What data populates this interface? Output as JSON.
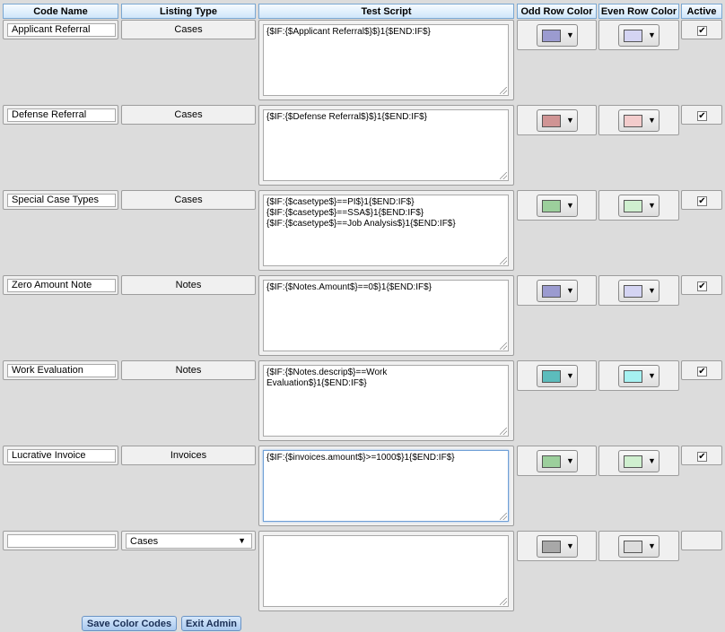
{
  "headers": {
    "code_name": "Code Name",
    "listing_type": "Listing Type",
    "test_script": "Test Script",
    "odd_row_color": "Odd Row Color",
    "even_row_color": "Even Row Color",
    "active": "Active"
  },
  "rows": [
    {
      "code_name": "Applicant Referral",
      "listing_type": "Cases",
      "script": "{$IF:{$Applicant Referral$}$}1{$END:IF$}",
      "odd_color": "#9b9bd0",
      "even_color": "#d4d4f3",
      "active": "✔"
    },
    {
      "code_name": "Defense Referral",
      "listing_type": "Cases",
      "script": "{$IF:{$Defense Referral$}$}1{$END:IF$}",
      "odd_color": "#d09494",
      "even_color": "#f3cccc",
      "active": "✔"
    },
    {
      "code_name": "Special Case Types",
      "listing_type": "Cases",
      "script": "{$IF:{$casetype$}==PI$}1{$END:IF$}\n{$IF:{$casetype$}==SSA$}1{$END:IF$}\n{$IF:{$casetype$}==Job Analysis$}1{$END:IF$}",
      "odd_color": "#9ccf9c",
      "even_color": "#cfefcf",
      "active": "✔"
    },
    {
      "code_name": "Zero Amount Note",
      "listing_type": "Notes",
      "script": "{$IF:{$Notes.Amount$}==0$}1{$END:IF$}",
      "odd_color": "#9b9bd0",
      "even_color": "#d4d4f3",
      "active": "✔"
    },
    {
      "code_name": "Work Evaluation",
      "listing_type": "Notes",
      "script": "{$IF:{$Notes.descrip$}==Work\nEvaluation$}1{$END:IF$}",
      "odd_color": "#5cbcbc",
      "even_color": "#a6f1f1",
      "active": "✔"
    },
    {
      "code_name": "Lucrative Invoice",
      "listing_type": "Invoices",
      "script": "{$IF:{$invoices.amount$}>=1000$}1{$END:IF$}",
      "odd_color": "#9ccf9c",
      "even_color": "#cfefcf",
      "active": "✔"
    }
  ],
  "new_row": {
    "code_name": "",
    "listing_type": "Cases",
    "script": "",
    "odd_color": "#a8a8a8",
    "even_color": "#dcdcdc"
  },
  "buttons": {
    "save": "Save Color Codes",
    "exit": "Exit Admin"
  },
  "icons": {
    "dropdown": "▼",
    "check": "✔"
  }
}
